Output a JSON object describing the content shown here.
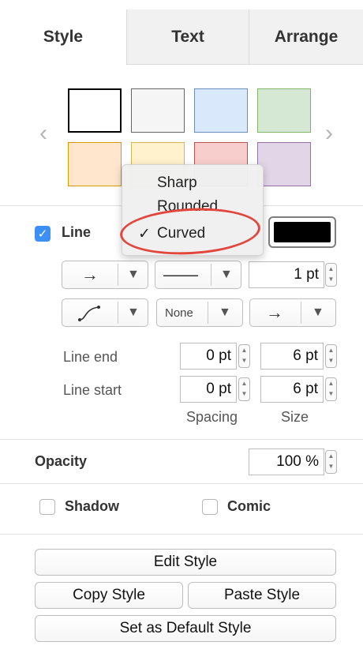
{
  "tabs": {
    "style": "Style",
    "text": "Text",
    "arrange": "Arrange"
  },
  "swatches": [
    {
      "fill": "#ffffff",
      "stroke": "#000000"
    },
    {
      "fill": "#f5f5f5",
      "stroke": "#666666"
    },
    {
      "fill": "#dae8fc",
      "stroke": "#6c8ebf"
    },
    {
      "fill": "#d5e8d4",
      "stroke": "#82b366"
    },
    {
      "fill": "#ffe6cc",
      "stroke": "#d79b00"
    },
    {
      "fill": "#fff2cc",
      "stroke": "#d6b656"
    },
    {
      "fill": "#f8cecc",
      "stroke": "#b85450"
    },
    {
      "fill": "#e1d5e7",
      "stroke": "#9673a6"
    }
  ],
  "nav": {
    "prev": "‹",
    "next": "›"
  },
  "line": {
    "label": "Line",
    "checked": true,
    "color": "#000000",
    "pattern_glyph": "→",
    "dash_glyph": "——",
    "width": "1 pt",
    "waypoint_glyph": "⤴",
    "line_start_marker": "None",
    "line_end_marker_glyph": "→",
    "line_end_label": "Line end",
    "line_start_label": "Line start",
    "line_end_spacing": "0 pt",
    "line_end_size": "6 pt",
    "line_start_spacing": "0 pt",
    "line_start_size": "6 pt",
    "spacing_label": "Spacing",
    "size_label": "Size"
  },
  "menu": {
    "items": [
      "Sharp",
      "Rounded",
      "Curved"
    ],
    "selected_check": "✓"
  },
  "opacity": {
    "label": "Opacity",
    "value": "100 %"
  },
  "options": {
    "shadow": "Shadow",
    "comic": "Comic"
  },
  "buttons": {
    "edit_style": "Edit Style",
    "copy_style": "Copy Style",
    "paste_style": "Paste Style",
    "set_default": "Set as Default Style"
  },
  "accent": "#e2473e"
}
